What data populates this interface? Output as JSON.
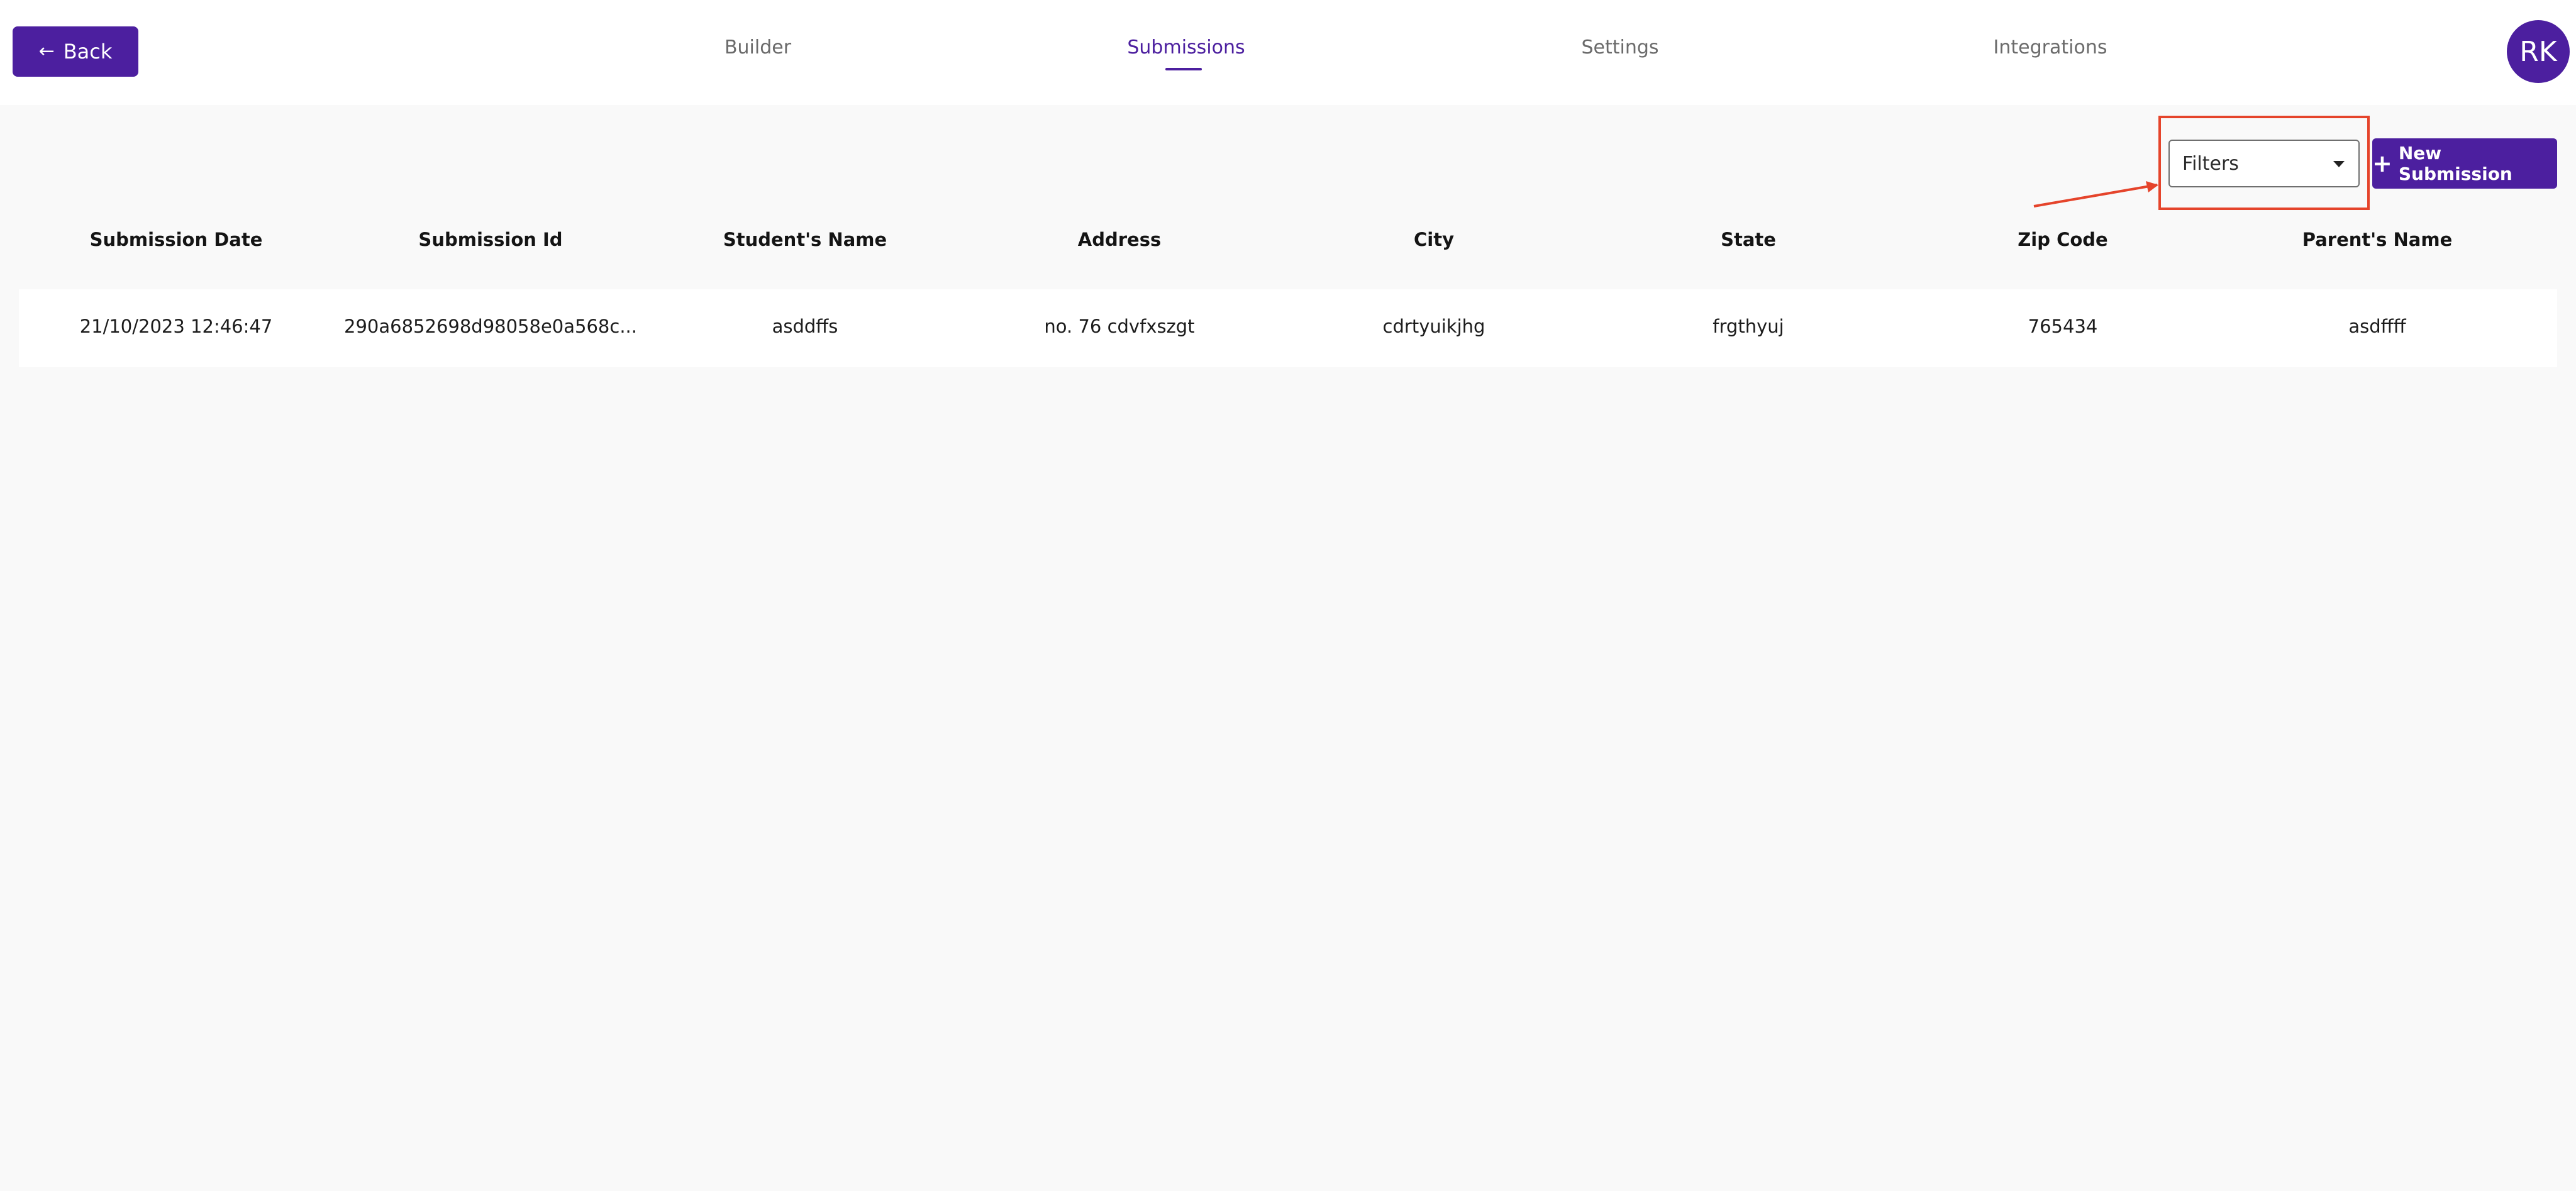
{
  "header": {
    "back_label": "Back",
    "tabs": [
      {
        "label": "Builder",
        "active": false
      },
      {
        "label": "Submissions",
        "active": true
      },
      {
        "label": "Settings",
        "active": false
      },
      {
        "label": "Integrations",
        "active": false
      }
    ],
    "avatar_initials": "RK"
  },
  "toolbar": {
    "filters_label": "Filters",
    "new_submission_label": "New Submission"
  },
  "table": {
    "columns": [
      "Submission Date",
      "Submission Id",
      "Student's Name",
      "Address",
      "City",
      "State",
      "Zip Code",
      "Parent's Name"
    ],
    "rows": [
      [
        "21/10/2023 12:46:47",
        "290a6852698d98058e0a568c...",
        "asddffs",
        "no. 76 cdvfxszgt",
        "cdrtyuikjhg",
        "frgthyuj",
        "765434",
        "asdffff"
      ]
    ]
  },
  "icons": {
    "back": "arrow-left-icon",
    "dropdown": "chevron-down-icon",
    "add": "plus-icon"
  },
  "colors": {
    "brand": "#4c1f9f",
    "annotation": "#e5442b",
    "background": "#f9f9f9"
  }
}
